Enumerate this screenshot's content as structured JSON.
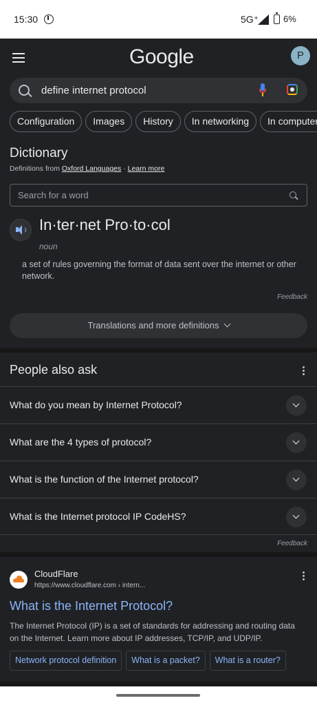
{
  "status": {
    "time": "15:30",
    "network": "5G⁺",
    "battery": "6%"
  },
  "header": {
    "logo": "Google",
    "avatar_letter": "P"
  },
  "search": {
    "query": "define internet protocol"
  },
  "chips": [
    "Configuration",
    "Images",
    "History",
    "In networking",
    "In computer"
  ],
  "dictionary": {
    "title": "Dictionary",
    "source_prefix": "Definitions from ",
    "source_name": "Oxford Languages",
    "source_sep": " · ",
    "learn_more": "Learn more",
    "search_placeholder": "Search for a word",
    "headword": "In·ter·net Pro·to·col",
    "part_of_speech": "noun",
    "definition": "a set of rules governing the format of data sent over the internet or other network.",
    "feedback": "Feedback",
    "more_button": "Translations and more definitions"
  },
  "people_also_ask": {
    "title": "People also ask",
    "questions": [
      "What do you mean by Internet Protocol?",
      "What are the 4 types of protocol?",
      "What is the function of the Internet protocol?",
      "What is the Internet protocol IP CodeHS?"
    ],
    "feedback": "Feedback"
  },
  "result": {
    "site_name": "CloudFlare",
    "url": "https://www.cloudflare.com › intern...",
    "title": "What is the Internet Protocol?",
    "snippet": "The Internet Protocol (IP) is a set of standards for addressing and routing data on the Internet. Learn more about IP addresses, TCP/IP, and UDP/IP.",
    "sitelinks": [
      "Network protocol definition",
      "What is a packet?",
      "What is a router?"
    ]
  }
}
